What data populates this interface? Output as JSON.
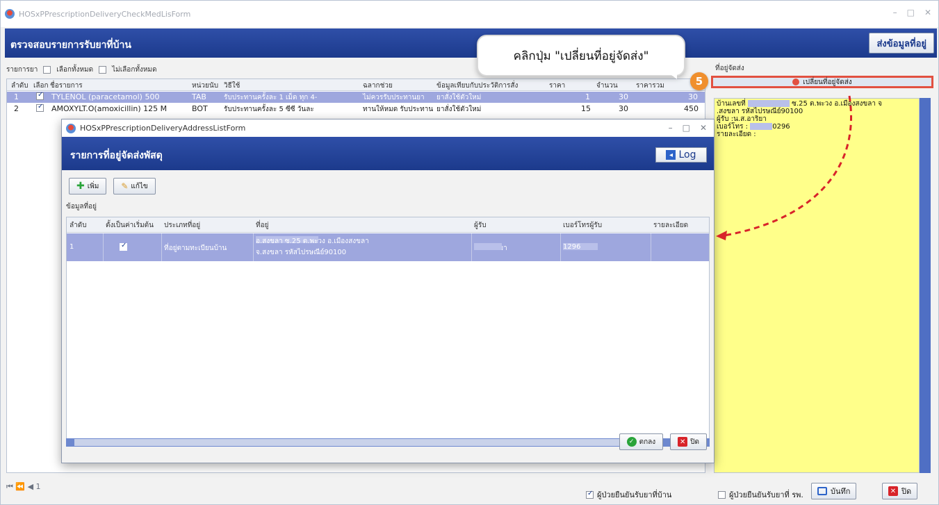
{
  "window": {
    "title": "HOSxPPrescriptionDeliveryCheckMedLisForm",
    "controls": [
      "–",
      "□",
      "✕"
    ]
  },
  "header": {
    "title": "ตรวจสอบรายการรับยาที่บ้าน",
    "send_button": "ส่งข้อมูลที่อยู่"
  },
  "toolbar": {
    "label": "รายการยา",
    "select_all": "เลือกทั้งหมด",
    "deselect_all": "ไม่เลือกทั้งหมด"
  },
  "grid": {
    "headers": [
      "ลำดับ",
      "เลือก",
      "ชื่อรายการ",
      "หน่วยนับ",
      "วิธีใช้",
      "ฉลากช่วย",
      "ข้อมูลเทียบกับประวัติการสั่ง",
      "ราคา",
      "จำนวน",
      "ราคารวม"
    ],
    "rows": [
      {
        "no": "1",
        "name": "TYLENOL (paracetamol) 500",
        "unit": "TAB",
        "usage": "รับประทานครั้งละ 1 เม็ด ทุก 4-",
        "label": "ไม่ควรรับประทานยา",
        "history": "ยาสั่งใช้ตัวใหม่",
        "price": "1",
        "qty": "30",
        "total": "30"
      },
      {
        "no": "2",
        "name": "AMOXYLT.O(amoxicillin) 125 M",
        "unit": "BOT",
        "usage": "รับประทานครั้งละ 5 ซีซี วันละ",
        "label": "ทานให้หมด รับประทาน",
        "history": "ยาสั่งใช้ตัวใหม่",
        "price": "15",
        "qty": "30",
        "total": "450"
      }
    ]
  },
  "nav": {
    "text": "⏮ ⏪ ◀ 1"
  },
  "right_panel": {
    "label": "ที่อยู่จัดส่ง",
    "change_button": "เปลี่ยนที่อยู่จัดส่ง",
    "line1": "บ้านเลขที่",
    "line1b": "ซ.25 ต.พะวง อ.เมืองสงขลา จ",
    "line2": ".สงขลา รหัสไปรษณีย์90100",
    "line3": "ผู้รับ :น.ส.อาริยา",
    "line4": "เบอร์โทร :",
    "line4b": "0296",
    "line5": "รายละเอียด :"
  },
  "callout": {
    "text": "คลิกปุ่ม \"เปลี่ยนที่อยู่จัดส่ง\"",
    "step": "5"
  },
  "dialog": {
    "title": "HOSxPPrescriptionDeliveryAddressListForm",
    "band_title": "รายการที่อยู่จัดส่งพัสดุ",
    "log_button": "Log",
    "add_button": "เพิ่ม",
    "edit_button": "แก้ไข",
    "section": "ข้อมูลที่อยู่",
    "headers": [
      "ลำดับ",
      "ตั้งเป็นค่าเริ่มต้น",
      "ประเภทที่อยู่",
      "ที่อยู่",
      "ผู้รับ",
      "เบอร์โทรผู้รับ",
      "รายละเอียด"
    ],
    "row": {
      "no": "1",
      "type": "ที่อยู่ตามทะเบียนบ้าน",
      "address1": "อ.สงขลา ซ.25 ต.พะวง อ.เมืองสงขลา",
      "address2": "จ.สงขลา รหัสไปรษณีย์90100",
      "receiver": "น.ส.อาริยา",
      "phone": "1296"
    },
    "ok_button": "ตกลง",
    "close_button": "ปิด"
  },
  "footer": {
    "confirm_home": "ผู้ป่วยยืนยันรับยาที่บ้าน",
    "confirm_hospital": "ผู้ป่วยยืนยันรับยาที่ รพ.",
    "save_button": "บันทึก",
    "close_button": "ปิด"
  },
  "colors": {
    "band": "#1c3a8c",
    "selected_row": "#9ea7de",
    "highlight": "#e25141",
    "callout_step": "#f08f2d",
    "address_bg": "#ffff8a"
  }
}
